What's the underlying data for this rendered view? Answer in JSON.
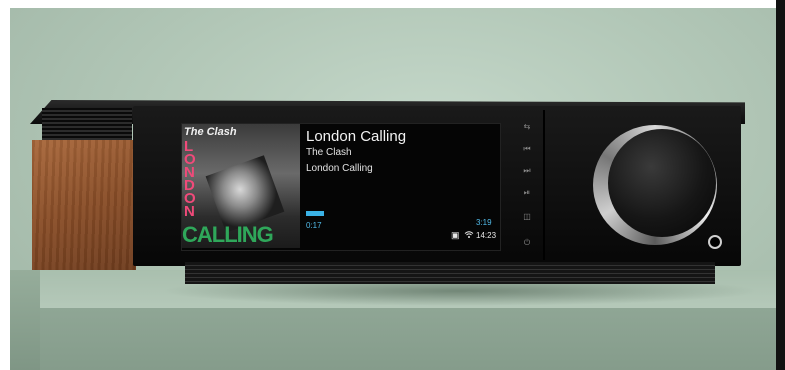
{
  "album_art": {
    "band": "The Clash",
    "top_word": "LONDON",
    "bottom_word": "CALLING"
  },
  "now_playing": {
    "title": "London Calling",
    "artist": "The Clash",
    "album": "London Calling",
    "elapsed": "0:17",
    "duration": "3:19",
    "progress_fraction": 0.09
  },
  "status_bar": {
    "clock": "14:23",
    "icons": [
      "memory-card-icon",
      "wifi-icon"
    ]
  },
  "front_buttons": [
    {
      "name": "source-button",
      "glyph": "⇆"
    },
    {
      "name": "previous-button",
      "glyph": "⏮"
    },
    {
      "name": "next-button",
      "glyph": "⏭"
    },
    {
      "name": "play-pause-button",
      "glyph": "⏯"
    },
    {
      "name": "input-button",
      "glyph": "◫"
    },
    {
      "name": "power-button",
      "glyph": "⏻"
    }
  ],
  "colors": {
    "wood": "#8a4e28",
    "accent": "#3bb2e6",
    "background": "#b3c8b8"
  }
}
